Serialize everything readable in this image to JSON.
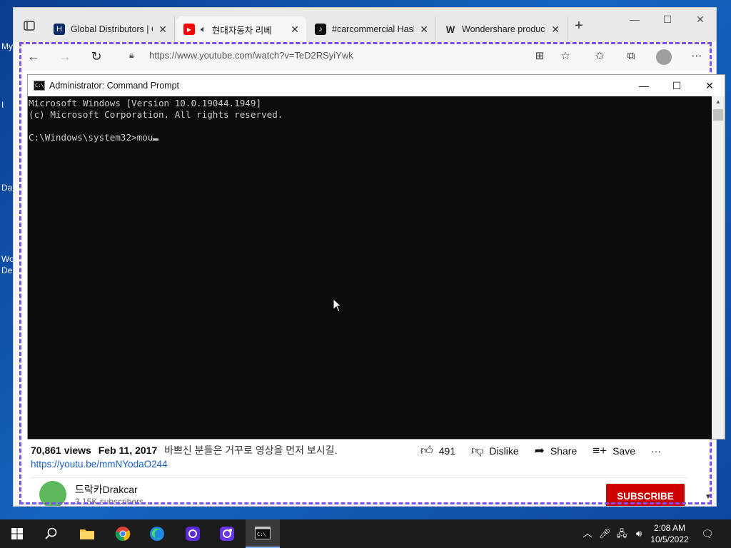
{
  "desktop": {
    "labels": [
      "My",
      "I",
      "Da",
      "Wo",
      "De"
    ]
  },
  "browser": {
    "tabs": [
      {
        "title": "Global Distributors | C",
        "favicon": "hyundai-icon"
      },
      {
        "title": "현대자동차 리베",
        "favicon": "youtube-icon",
        "audio": "speaker-icon",
        "active": true
      },
      {
        "title": "#carcommercial Hash",
        "favicon": "tiktok-icon"
      },
      {
        "title": "Wondershare produc",
        "favicon": "wondershare-icon"
      }
    ],
    "new_tab": "+",
    "url": "https://www.youtube.com/watch?v=TeD2RSyiYwk"
  },
  "youtube": {
    "views": "70,861 views",
    "date": "Feb 11, 2017",
    "description": "바쁘신 분들은 거꾸로 영상을 먼저 보시길.",
    "link": "https://youtu.be/mmNYodaO244",
    "likes": "491",
    "dislike_label": "Dislike",
    "share_label": "Share",
    "save_label": "Save",
    "more_label": "···",
    "channel_name": "드락카Drakcar",
    "subscribers": "3.15K subscribers",
    "subscribe_label": "SUBSCRIBE"
  },
  "cmd": {
    "title": "Administrator: Command Prompt",
    "icon_text": "C:\\",
    "lines": [
      "Microsoft Windows [Version 10.0.19044.1949]",
      "(c) Microsoft Corporation. All rights reserved.",
      "",
      "C:\\Windows\\system32>mou"
    ]
  },
  "taskbar": {
    "time": "2:08 AM",
    "date": "10/5/2022"
  },
  "colors": {
    "accent_dashed": "#7b4ff0",
    "subscribe": "#cc0000",
    "link": "#1a5fc8",
    "youtube_red": "#ff0000"
  }
}
